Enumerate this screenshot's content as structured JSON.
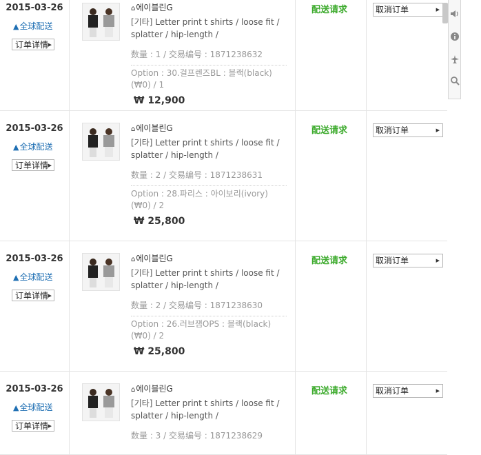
{
  "orders": [
    {
      "date": "2015-03-26",
      "ship_label": "全球配送",
      "detail_label": "订单详情",
      "seller": "에이블린G",
      "title": "[기타] Letter print t shirts / loose fit / splatter / hip-length /",
      "qty_line": "数量 : 1 / 交易编号 : 1871238632",
      "option": "Option : 30.걸프렌즈BL : 블랙(black) (₩0) / 1",
      "price": "₩ 12,900",
      "status": "配送请求",
      "cancel_label": "取消订单"
    },
    {
      "date": "2015-03-26",
      "ship_label": "全球配送",
      "detail_label": "订单详情",
      "seller": "에이블린G",
      "title": "[기타] Letter print t shirts / loose fit / splatter / hip-length /",
      "qty_line": "数量 : 2 / 交易编号 : 1871238631",
      "option": "Option : 28.파리스 : 아이보리(ivory) (₩0) / 2",
      "price": "₩ 25,800",
      "status": "配送请求",
      "cancel_label": "取消订单"
    },
    {
      "date": "2015-03-26",
      "ship_label": "全球配送",
      "detail_label": "订单详情",
      "seller": "에이블린G",
      "title": "[기타] Letter print t shirts / loose fit / splatter / hip-length /",
      "qty_line": "数量 : 2 / 交易编号 : 1871238630",
      "option": "Option : 26.러브잼OPS : 블랙(black) (₩0) / 2",
      "price": "₩ 25,800",
      "status": "配送请求",
      "cancel_label": "取消订单"
    },
    {
      "date": "2015-03-26",
      "ship_label": "全球配送",
      "detail_label": "订单详情",
      "seller": "에이블린G",
      "title": "[기타] Letter print t shirts / loose fit / splatter / hip-length /",
      "qty_line": "数量 : 3 / 交易编号 : 1871238629",
      "status": "配送请求",
      "cancel_label": "取消订单"
    }
  ],
  "side_toolbar": [
    {
      "icon": "speaker-icon"
    },
    {
      "icon": "info-icon"
    },
    {
      "icon": "airplane-icon"
    },
    {
      "icon": "search-icon"
    }
  ],
  "colors": {
    "status": "#3eab2e",
    "ship_link": "#1f6fb3",
    "border": "#e4e4e4"
  }
}
